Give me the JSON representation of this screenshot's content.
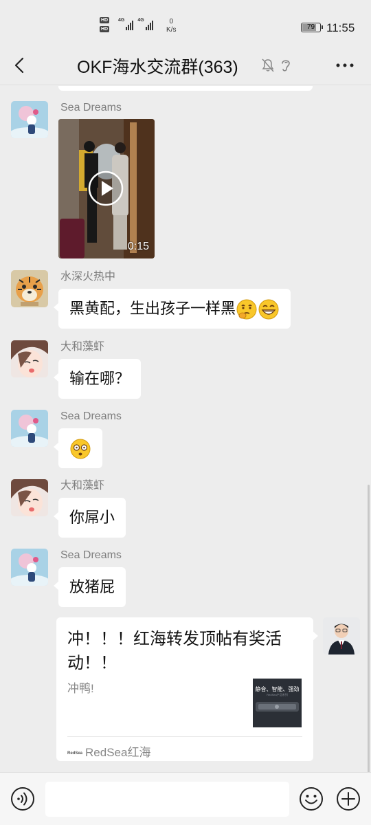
{
  "status_bar": {
    "hd1": "HD",
    "hd2": "HD",
    "signal1": "4G",
    "signal2": "4G",
    "speed_value": "0",
    "speed_unit": "K/s",
    "battery": "79",
    "time": "11:55"
  },
  "header": {
    "title": "OKF海水交流群(363)",
    "icons": [
      "back-icon",
      "mute-icon",
      "earpiece-icon",
      "more-icon"
    ]
  },
  "messages": [
    {
      "sender": "Sea Dreams",
      "type": "video",
      "duration": "0:15",
      "avatar": "astronaut-avatar"
    },
    {
      "sender": "水深火热中",
      "type": "text",
      "text": "黑黄配，生出孩子一样黑",
      "emojis": [
        "thinking-emoji",
        "grin-emoji"
      ],
      "avatar": "tiger-avatar"
    },
    {
      "sender": "大和藻虾",
      "type": "text",
      "text": "输在哪？",
      "avatar": "anime-girl-avatar"
    },
    {
      "sender": "Sea Dreams",
      "type": "emoji",
      "emojis": [
        "dizzy-face-emoji"
      ],
      "avatar": "astronaut-avatar"
    },
    {
      "sender": "大和藻虾",
      "type": "text",
      "text": "你屌小",
      "avatar": "anime-girl-avatar"
    },
    {
      "sender": "Sea Dreams",
      "type": "text",
      "text": "放猪屁",
      "avatar": "astronaut-avatar"
    }
  ],
  "self_link_card": {
    "title": "冲！！！红海转发顶帖有奖活动！！",
    "description": "冲鸭!",
    "thumbnail_text": "静音、智能、强劲",
    "thumbnail_subtext": "RedSea产品系列",
    "source_logo": "RedSea",
    "source": "RedSea红海"
  },
  "input_bar": {
    "placeholder": "",
    "icons": [
      "voice-icon",
      "emoji-icon",
      "plus-icon"
    ]
  }
}
